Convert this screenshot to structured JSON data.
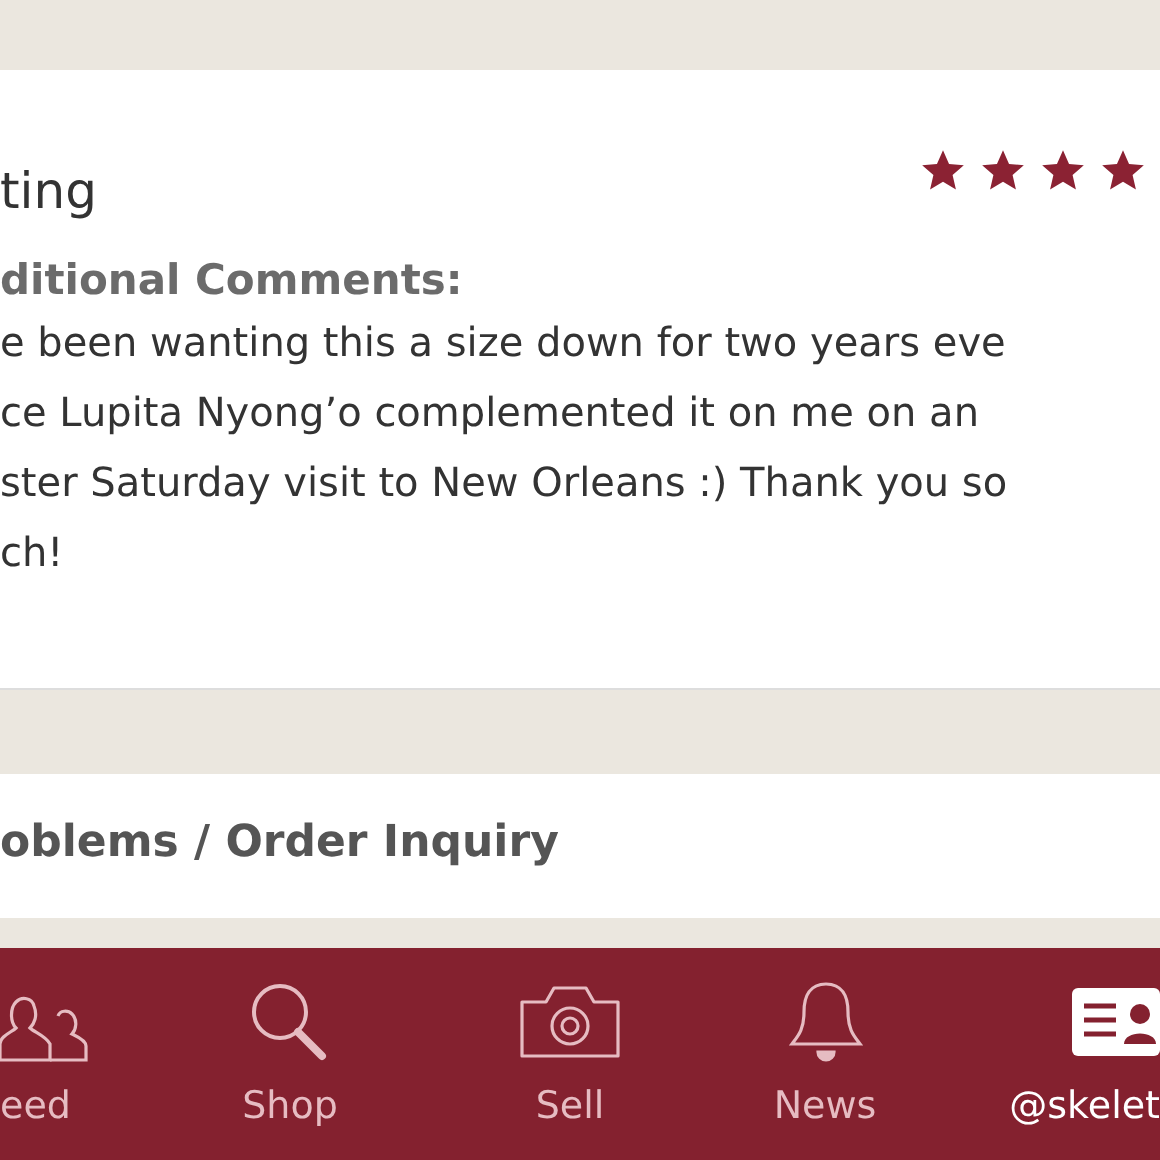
{
  "review_card": {
    "heading": "ting",
    "stars": 4,
    "comments_label": "ditional Comments:",
    "comment_lines": [
      "e been wanting this a size down for two years eve",
      "ce Lupita Nyong’o complemented it on me on an",
      "ster Saturday visit to New Orleans :) Thank you so",
      "ch!"
    ]
  },
  "inquiry_card": {
    "title": "oblems / Order Inquiry"
  },
  "nav": [
    {
      "kind": "people",
      "label": "eed",
      "selected": false
    },
    {
      "kind": "search",
      "label": "Shop",
      "selected": false
    },
    {
      "kind": "camera",
      "label": "Sell",
      "selected": false
    },
    {
      "kind": "bell",
      "label": "News",
      "selected": false
    },
    {
      "kind": "card",
      "label": "@skelet",
      "selected": true
    }
  ]
}
